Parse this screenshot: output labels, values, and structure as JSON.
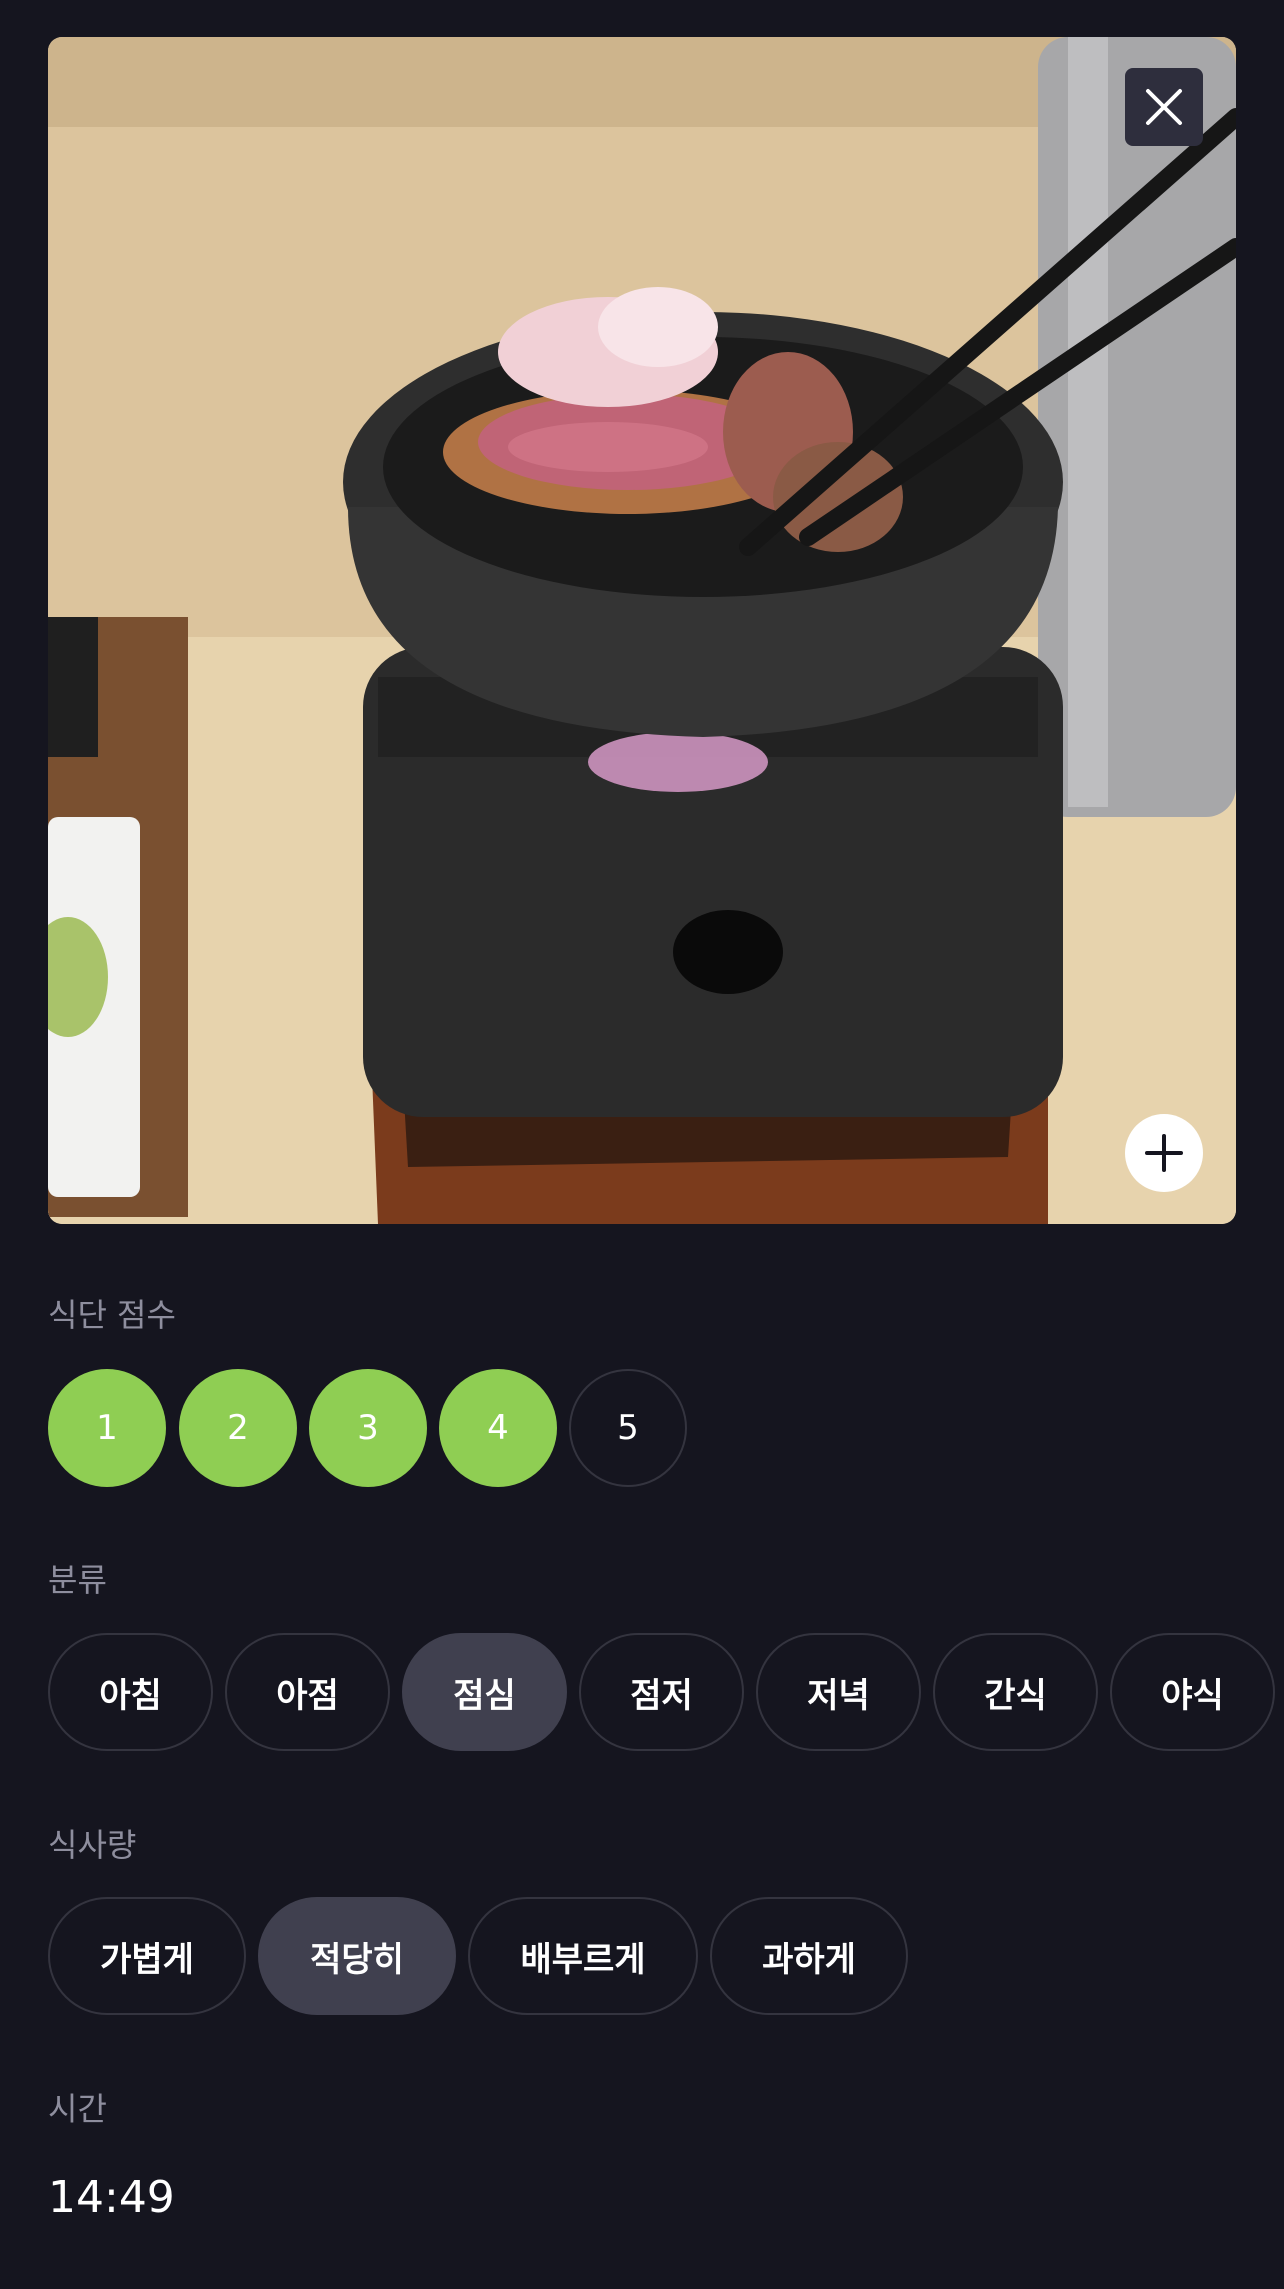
{
  "photo": {
    "alt_icon": "food-photo",
    "close_icon": "close-icon",
    "add_icon": "plus-icon"
  },
  "score": {
    "label": "식단 점수",
    "options": [
      "1",
      "2",
      "3",
      "4",
      "5"
    ],
    "selected_value": 4,
    "active_color": "#8fce53"
  },
  "category": {
    "label": "분류",
    "options": [
      "아침",
      "아점",
      "점심",
      "점저",
      "저녁",
      "간식",
      "야식"
    ],
    "selected": "점심"
  },
  "amount": {
    "label": "식사량",
    "options": [
      "가볍게",
      "적당히",
      "배부르게",
      "과하게"
    ],
    "selected": "적당히"
  },
  "time": {
    "label": "시간",
    "value": "14:49"
  },
  "colors": {
    "background": "#15151f",
    "chip_selected": "#40404f",
    "chip_border": "#34343f"
  }
}
